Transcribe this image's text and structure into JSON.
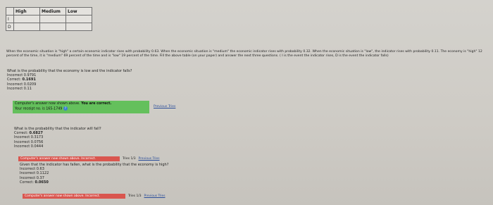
{
  "table": {
    "headers": [
      "",
      "High",
      "Medium",
      "Low"
    ],
    "row_labels": [
      "I",
      "D"
    ]
  },
  "problem_text": "When the economic situation is \"high\" a certain economic indicator rises with probability 0.63. When the economic situation is \"medium\" the economic indicator rises with probability 0.32. When the economic situation is \"low\", the indicator rises with probability 0.11. The economy is \"high\" 12 percent of the time, it is \"medium\" 69 percent of the time and is \"low\" 19 percent of the time. Fill the above table (on your paper) and answer the next three questions. ( I is the event the indicator rises, D is the event the indicator falls)",
  "q1": {
    "question": "What is the probability that the economy is low and the indicator falls?",
    "choices": [
      {
        "status": "Incorrect",
        "value": "0.9791"
      },
      {
        "status": "Correct:",
        "value": "0.1691"
      },
      {
        "status": "Incorrect",
        "value": "0.0209"
      },
      {
        "status": "Incorrect",
        "value": "0.11"
      }
    ],
    "feedback_line1": "Computer's answer now shown above.",
    "feedback_correct": "You are correct.",
    "feedback_receipt": "Your receipt no. is 165-1749",
    "receipt_icon": "?",
    "previous_tries": "Previous Tries"
  },
  "q2": {
    "question": "What is the probability that the indicator will fall?",
    "choices": [
      {
        "status": "Correct:",
        "value": "0.6827"
      },
      {
        "status": "Incorrect",
        "value": "0.3173"
      },
      {
        "status": "Incorrect",
        "value": "0.0756"
      },
      {
        "status": "Incorrect",
        "value": "0.0444"
      }
    ],
    "feedback": "Computer's answer now shown above. Incorrect.",
    "tries": "Tries 1/3",
    "previous_tries": "Previous Tries"
  },
  "q3": {
    "question": "Given that the indicator has fallen, what is the probability that the economy is high?",
    "choices": [
      {
        "status": "Incorrect",
        "value": "0.63"
      },
      {
        "status": "Incorrect",
        "value": "0.1122"
      },
      {
        "status": "Incorrect",
        "value": "0.37"
      },
      {
        "status": "Correct:",
        "value": "0.0650"
      }
    ],
    "feedback": "Computer's answer now shown above. Incorrect.",
    "tries": "Tries 1/3",
    "previous_tries": "Previous Tries"
  },
  "colors": {
    "correct_feedback": "#64c05c",
    "incorrect_feedback": "#d9564f",
    "link": "#2a4d9a"
  }
}
